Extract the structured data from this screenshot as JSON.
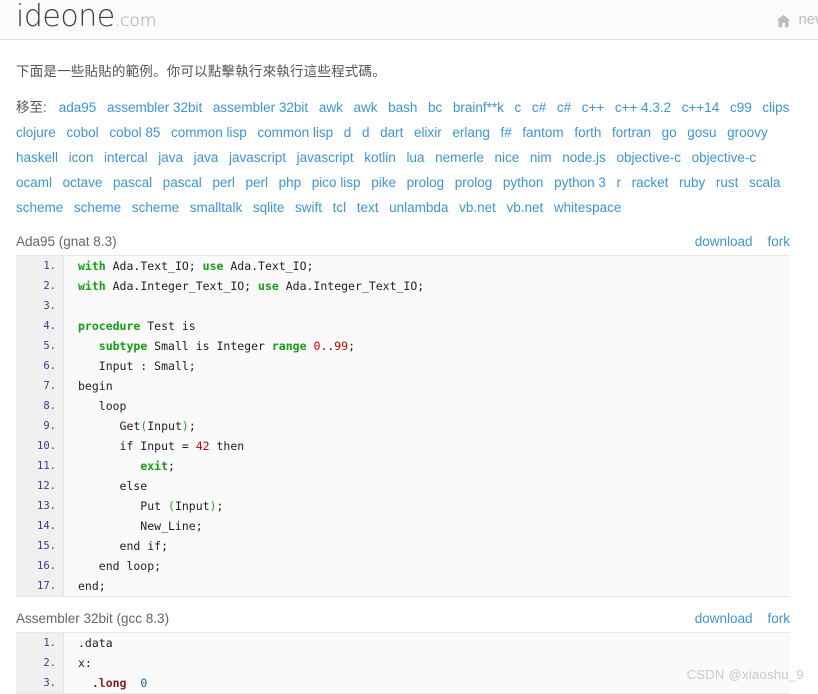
{
  "header": {
    "logo_main": "ideone",
    "logo_suffix": ".com",
    "home_icon": "home-icon",
    "nav_label": "new"
  },
  "intro": {
    "text": "下面是一些貼貼的範例。你可以點擊執行來執行這些程式碼。"
  },
  "languages": {
    "label": "移至:",
    "items": [
      "ada95",
      "assembler 32bit",
      "assembler 32bit",
      "awk",
      "awk",
      "bash",
      "bc",
      "brainf**k",
      "c",
      "c#",
      "c#",
      "c++",
      "c++ 4.3.2",
      "c++14",
      "c99",
      "clips",
      "clojure",
      "cobol",
      "cobol 85",
      "common lisp",
      "common lisp",
      "d",
      "d",
      "dart",
      "elixir",
      "erlang",
      "f#",
      "fantom",
      "forth",
      "fortran",
      "go",
      "gosu",
      "groovy",
      "haskell",
      "icon",
      "intercal",
      "java",
      "java",
      "javascript",
      "javascript",
      "kotlin",
      "lua",
      "nemerle",
      "nice",
      "nim",
      "node.js",
      "objective-c",
      "objective-c",
      "ocaml",
      "octave",
      "pascal",
      "pascal",
      "perl",
      "perl",
      "php",
      "pico lisp",
      "pike",
      "prolog",
      "prolog",
      "python",
      "python 3",
      "r",
      "racket",
      "ruby",
      "rust",
      "scala",
      "scheme",
      "scheme",
      "scheme",
      "smalltalk",
      "sqlite",
      "swift",
      "tcl",
      "text",
      "unlambda",
      "vb.net",
      "vb.net",
      "whitespace"
    ]
  },
  "code_sections": [
    {
      "title": "Ada95 (gnat 8.3)",
      "download_label": "download",
      "fork_label": "fork",
      "lines": [
        {
          "n": "1.",
          "tokens": [
            {
              "t": "with",
              "c": "kw"
            },
            {
              "t": " Ada.Text_IO; ",
              "c": ""
            },
            {
              "t": "use",
              "c": "kw"
            },
            {
              "t": " Ada.Text_IO;",
              "c": ""
            }
          ]
        },
        {
          "n": "2.",
          "tokens": [
            {
              "t": "with",
              "c": "kw"
            },
            {
              "t": " Ada.Integer_Text_IO; ",
              "c": ""
            },
            {
              "t": "use",
              "c": "kw"
            },
            {
              "t": " Ada.Integer_Text_IO;",
              "c": ""
            }
          ]
        },
        {
          "n": "3.",
          "tokens": [
            {
              "t": "",
              "c": ""
            }
          ]
        },
        {
          "n": "4.",
          "tokens": [
            {
              "t": "procedure",
              "c": "kw"
            },
            {
              "t": " Test is",
              "c": ""
            }
          ]
        },
        {
          "n": "5.",
          "tokens": [
            {
              "t": "   ",
              "c": ""
            },
            {
              "t": "subtype",
              "c": "kw"
            },
            {
              "t": " Small is Integer ",
              "c": ""
            },
            {
              "t": "range",
              "c": "kw"
            },
            {
              "t": " ",
              "c": ""
            },
            {
              "t": "0",
              "c": "num"
            },
            {
              "t": "..",
              "c": ""
            },
            {
              "t": "99",
              "c": "num"
            },
            {
              "t": ";",
              "c": ""
            }
          ]
        },
        {
          "n": "6.",
          "tokens": [
            {
              "t": "   Input : Small;",
              "c": ""
            }
          ]
        },
        {
          "n": "7.",
          "tokens": [
            {
              "t": "begin",
              "c": ""
            }
          ]
        },
        {
          "n": "8.",
          "tokens": [
            {
              "t": "   loop",
              "c": ""
            }
          ]
        },
        {
          "n": "9.",
          "tokens": [
            {
              "t": "      Get",
              "c": ""
            },
            {
              "t": "(",
              "c": "op"
            },
            {
              "t": "Input",
              "c": ""
            },
            {
              "t": ")",
              "c": "op"
            },
            {
              "t": ";",
              "c": ""
            }
          ]
        },
        {
          "n": "10.",
          "tokens": [
            {
              "t": "      if Input = ",
              "c": ""
            },
            {
              "t": "42",
              "c": "num"
            },
            {
              "t": " then",
              "c": ""
            }
          ]
        },
        {
          "n": "11.",
          "tokens": [
            {
              "t": "         ",
              "c": ""
            },
            {
              "t": "exit",
              "c": "kw"
            },
            {
              "t": ";",
              "c": ""
            }
          ]
        },
        {
          "n": "12.",
          "tokens": [
            {
              "t": "      else",
              "c": ""
            }
          ]
        },
        {
          "n": "13.",
          "tokens": [
            {
              "t": "         Put ",
              "c": ""
            },
            {
              "t": "(",
              "c": "op"
            },
            {
              "t": "Input",
              "c": ""
            },
            {
              "t": ")",
              "c": "op"
            },
            {
              "t": ";",
              "c": ""
            }
          ]
        },
        {
          "n": "14.",
          "tokens": [
            {
              "t": "         New_Line;",
              "c": ""
            }
          ]
        },
        {
          "n": "15.",
          "tokens": [
            {
              "t": "      end if;",
              "c": ""
            }
          ]
        },
        {
          "n": "16.",
          "tokens": [
            {
              "t": "   end loop;",
              "c": ""
            }
          ]
        },
        {
          "n": "17.",
          "tokens": [
            {
              "t": "end;",
              "c": ""
            }
          ]
        }
      ]
    },
    {
      "title": "Assembler 32bit (gcc 8.3)",
      "download_label": "download",
      "fork_label": "fork",
      "lines": [
        {
          "n": "1.",
          "tokens": [
            {
              "t": ".data",
              "c": ""
            }
          ]
        },
        {
          "n": "2.",
          "tokens": [
            {
              "t": "x:",
              "c": ""
            }
          ]
        },
        {
          "n": "3.",
          "tokens": [
            {
              "t": "  ",
              "c": ""
            },
            {
              "t": ".long",
              "c": "dir"
            },
            {
              "t": "  ",
              "c": ""
            },
            {
              "t": "0",
              "c": "anum"
            }
          ]
        }
      ]
    }
  ],
  "watermark": "CSDN @xiaoshu_9",
  "colors": {
    "link": "#3d95d3",
    "keyword": "#12a012",
    "number": "#cc0000",
    "directive": "#8b1a1a",
    "gutter_bg": "#f0f0f0",
    "code_bg": "#fafafa"
  }
}
